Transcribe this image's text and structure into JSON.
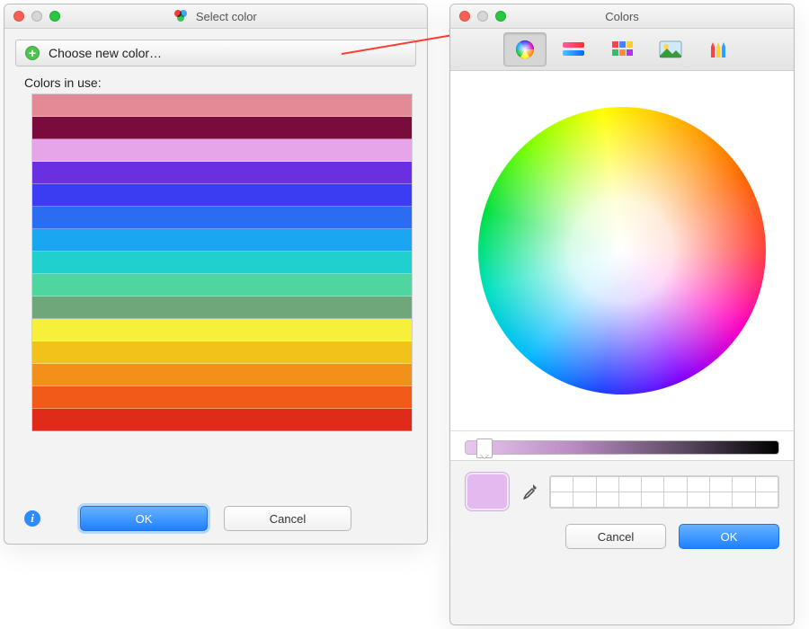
{
  "select_window": {
    "title": "Select color",
    "choose_label": "Choose new color…",
    "in_use_label": "Colors in use:",
    "ok_label": "OK",
    "cancel_label": "Cancel",
    "swatches": [
      "#e48a96",
      "#7a0b3d",
      "#e6a5e8",
      "#6a2fe0",
      "#3a3df2",
      "#2a6cf2",
      "#1aa6f0",
      "#1fd0cf",
      "#4fd6a0",
      "#6fa77a",
      "#f7f03a",
      "#f2c21a",
      "#f2911a",
      "#f25a1a",
      "#e02a1a"
    ]
  },
  "colors_window": {
    "title": "Colors",
    "tabs": [
      "wheel",
      "sliders",
      "palettes",
      "image",
      "crayons"
    ],
    "active_tab": "wheel",
    "current_color": "#e4b9f0",
    "ok_label": "OK",
    "cancel_label": "Cancel"
  }
}
